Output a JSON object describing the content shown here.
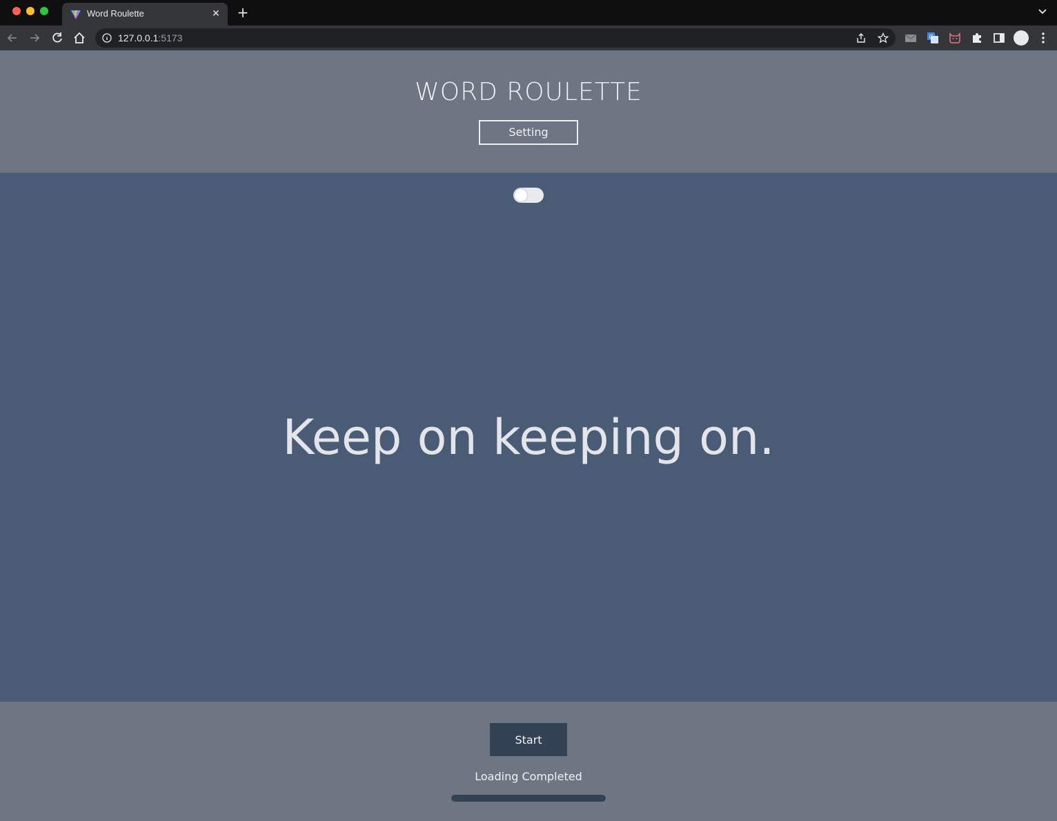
{
  "browser": {
    "tab_title": "Word Roulette",
    "url_host": "127.0.0.1",
    "url_port": ":5173",
    "new_tab_symbol": "+",
    "close_symbol": "✕"
  },
  "header": {
    "title": "WORD ROULETTE",
    "setting_label": "Setting"
  },
  "main": {
    "toggle_on": false,
    "phrase": "Keep on keeping on."
  },
  "footer": {
    "start_label": "Start",
    "status": "Loading Completed",
    "progress": 1.0
  },
  "colors": {
    "header_bg": "#6e7583",
    "main_bg": "#4a5b75",
    "button_dark": "#344256"
  },
  "icons": [
    "back-icon",
    "forward-icon",
    "reload-icon",
    "home-icon",
    "info-icon",
    "share-icon",
    "star-icon",
    "mail-icon",
    "translate-icon",
    "cat-icon",
    "puzzle-icon",
    "sidebar-icon",
    "kebab-menu-icon",
    "chevron-down-icon"
  ]
}
